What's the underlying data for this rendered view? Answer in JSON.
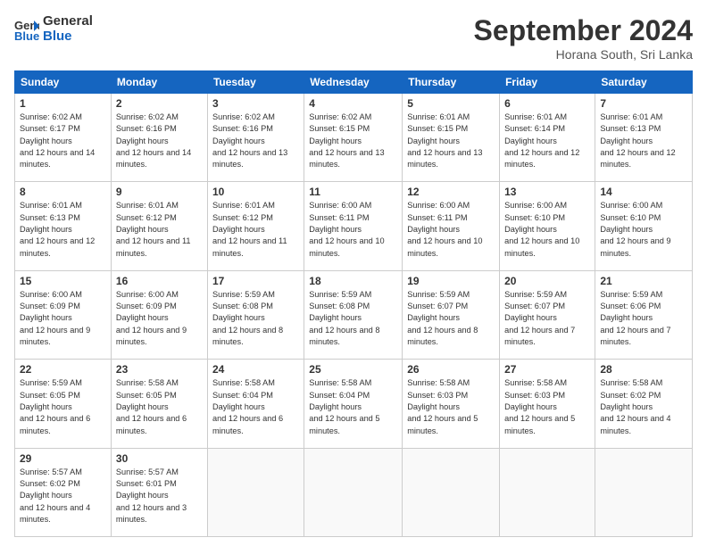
{
  "header": {
    "logo_line1": "General",
    "logo_line2": "Blue",
    "month": "September 2024",
    "location": "Horana South, Sri Lanka"
  },
  "days_of_week": [
    "Sunday",
    "Monday",
    "Tuesday",
    "Wednesday",
    "Thursday",
    "Friday",
    "Saturday"
  ],
  "weeks": [
    [
      {
        "num": "1",
        "rise": "6:02 AM",
        "set": "6:17 PM",
        "daylight": "12 hours and 14 minutes."
      },
      {
        "num": "2",
        "rise": "6:02 AM",
        "set": "6:16 PM",
        "daylight": "12 hours and 14 minutes."
      },
      {
        "num": "3",
        "rise": "6:02 AM",
        "set": "6:16 PM",
        "daylight": "12 hours and 13 minutes."
      },
      {
        "num": "4",
        "rise": "6:02 AM",
        "set": "6:15 PM",
        "daylight": "12 hours and 13 minutes."
      },
      {
        "num": "5",
        "rise": "6:01 AM",
        "set": "6:15 PM",
        "daylight": "12 hours and 13 minutes."
      },
      {
        "num": "6",
        "rise": "6:01 AM",
        "set": "6:14 PM",
        "daylight": "12 hours and 12 minutes."
      },
      {
        "num": "7",
        "rise": "6:01 AM",
        "set": "6:13 PM",
        "daylight": "12 hours and 12 minutes."
      }
    ],
    [
      {
        "num": "8",
        "rise": "6:01 AM",
        "set": "6:13 PM",
        "daylight": "12 hours and 12 minutes."
      },
      {
        "num": "9",
        "rise": "6:01 AM",
        "set": "6:12 PM",
        "daylight": "12 hours and 11 minutes."
      },
      {
        "num": "10",
        "rise": "6:01 AM",
        "set": "6:12 PM",
        "daylight": "12 hours and 11 minutes."
      },
      {
        "num": "11",
        "rise": "6:00 AM",
        "set": "6:11 PM",
        "daylight": "12 hours and 10 minutes."
      },
      {
        "num": "12",
        "rise": "6:00 AM",
        "set": "6:11 PM",
        "daylight": "12 hours and 10 minutes."
      },
      {
        "num": "13",
        "rise": "6:00 AM",
        "set": "6:10 PM",
        "daylight": "12 hours and 10 minutes."
      },
      {
        "num": "14",
        "rise": "6:00 AM",
        "set": "6:10 PM",
        "daylight": "12 hours and 9 minutes."
      }
    ],
    [
      {
        "num": "15",
        "rise": "6:00 AM",
        "set": "6:09 PM",
        "daylight": "12 hours and 9 minutes."
      },
      {
        "num": "16",
        "rise": "6:00 AM",
        "set": "6:09 PM",
        "daylight": "12 hours and 9 minutes."
      },
      {
        "num": "17",
        "rise": "5:59 AM",
        "set": "6:08 PM",
        "daylight": "12 hours and 8 minutes."
      },
      {
        "num": "18",
        "rise": "5:59 AM",
        "set": "6:08 PM",
        "daylight": "12 hours and 8 minutes."
      },
      {
        "num": "19",
        "rise": "5:59 AM",
        "set": "6:07 PM",
        "daylight": "12 hours and 8 minutes."
      },
      {
        "num": "20",
        "rise": "5:59 AM",
        "set": "6:07 PM",
        "daylight": "12 hours and 7 minutes."
      },
      {
        "num": "21",
        "rise": "5:59 AM",
        "set": "6:06 PM",
        "daylight": "12 hours and 7 minutes."
      }
    ],
    [
      {
        "num": "22",
        "rise": "5:59 AM",
        "set": "6:05 PM",
        "daylight": "12 hours and 6 minutes."
      },
      {
        "num": "23",
        "rise": "5:58 AM",
        "set": "6:05 PM",
        "daylight": "12 hours and 6 minutes."
      },
      {
        "num": "24",
        "rise": "5:58 AM",
        "set": "6:04 PM",
        "daylight": "12 hours and 6 minutes."
      },
      {
        "num": "25",
        "rise": "5:58 AM",
        "set": "6:04 PM",
        "daylight": "12 hours and 5 minutes."
      },
      {
        "num": "26",
        "rise": "5:58 AM",
        "set": "6:03 PM",
        "daylight": "12 hours and 5 minutes."
      },
      {
        "num": "27",
        "rise": "5:58 AM",
        "set": "6:03 PM",
        "daylight": "12 hours and 5 minutes."
      },
      {
        "num": "28",
        "rise": "5:58 AM",
        "set": "6:02 PM",
        "daylight": "12 hours and 4 minutes."
      }
    ],
    [
      {
        "num": "29",
        "rise": "5:57 AM",
        "set": "6:02 PM",
        "daylight": "12 hours and 4 minutes."
      },
      {
        "num": "30",
        "rise": "5:57 AM",
        "set": "6:01 PM",
        "daylight": "12 hours and 3 minutes."
      },
      null,
      null,
      null,
      null,
      null
    ]
  ]
}
